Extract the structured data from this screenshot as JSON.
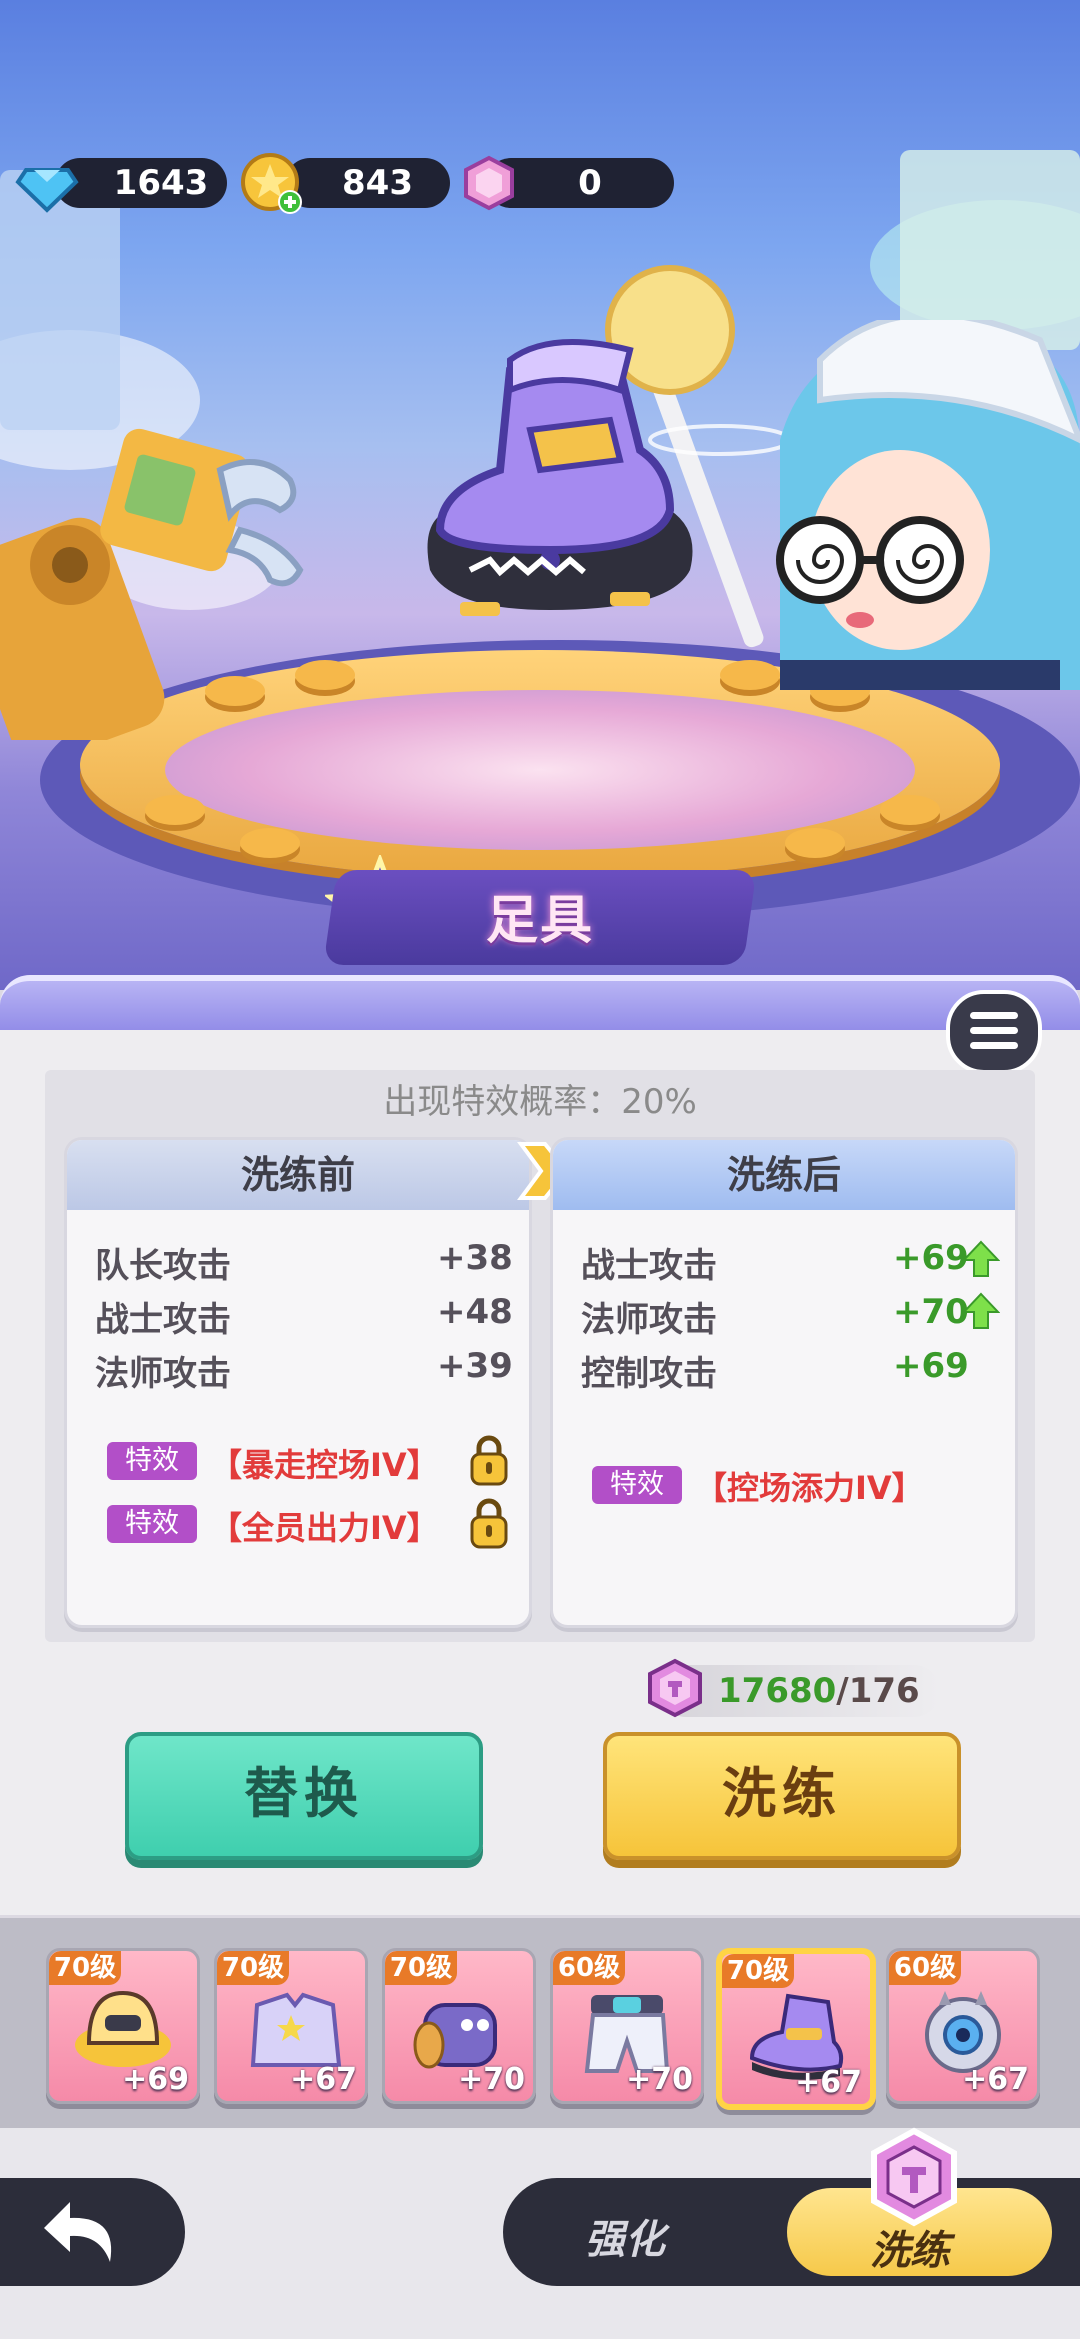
{
  "currency": {
    "diamond": "1643",
    "gold": "843",
    "gem": "0"
  },
  "equipment_slot_title": "足具",
  "panel": {
    "probability_text": "出现特效概率：20%",
    "before": {
      "header": "洗练前",
      "stats": [
        {
          "name": "队长攻击",
          "value": "+38"
        },
        {
          "name": "战士攻击",
          "value": "+48"
        },
        {
          "name": "法师攻击",
          "value": "+39"
        }
      ],
      "effects": [
        {
          "tag": "特效",
          "name": "【暴走控场IV】"
        },
        {
          "tag": "特效",
          "name": "【全员出力IV】"
        }
      ]
    },
    "after": {
      "header": "洗练后",
      "stats": [
        {
          "name": "战士攻击",
          "value": "+69"
        },
        {
          "name": "法师攻击",
          "value": "+70"
        },
        {
          "name": "控制攻击",
          "value": "+69"
        }
      ],
      "effects": [
        {
          "tag": "特效",
          "name": "【控场添力IV】"
        }
      ]
    },
    "cost": {
      "have": "17680",
      "need": "/176"
    },
    "replace_label": "替换",
    "train_label": "洗练"
  },
  "equipment": [
    {
      "level": "70级",
      "plus": "+69",
      "icon": "hat-icon"
    },
    {
      "level": "70级",
      "plus": "+67",
      "icon": "jacket-icon"
    },
    {
      "level": "70级",
      "plus": "+70",
      "icon": "bracer-icon"
    },
    {
      "level": "60级",
      "plus": "+70",
      "icon": "pants-icon"
    },
    {
      "level": "70级",
      "plus": "+67",
      "icon": "shoe-icon"
    },
    {
      "level": "60级",
      "plus": "+67",
      "icon": "orb-icon"
    }
  ],
  "tabs": {
    "enhance": "强化",
    "refine": "洗练"
  },
  "colors": {
    "up_green": "#3a9a2a",
    "effect_red": "#e23b3b",
    "tag_purple": "#b24fc8"
  }
}
